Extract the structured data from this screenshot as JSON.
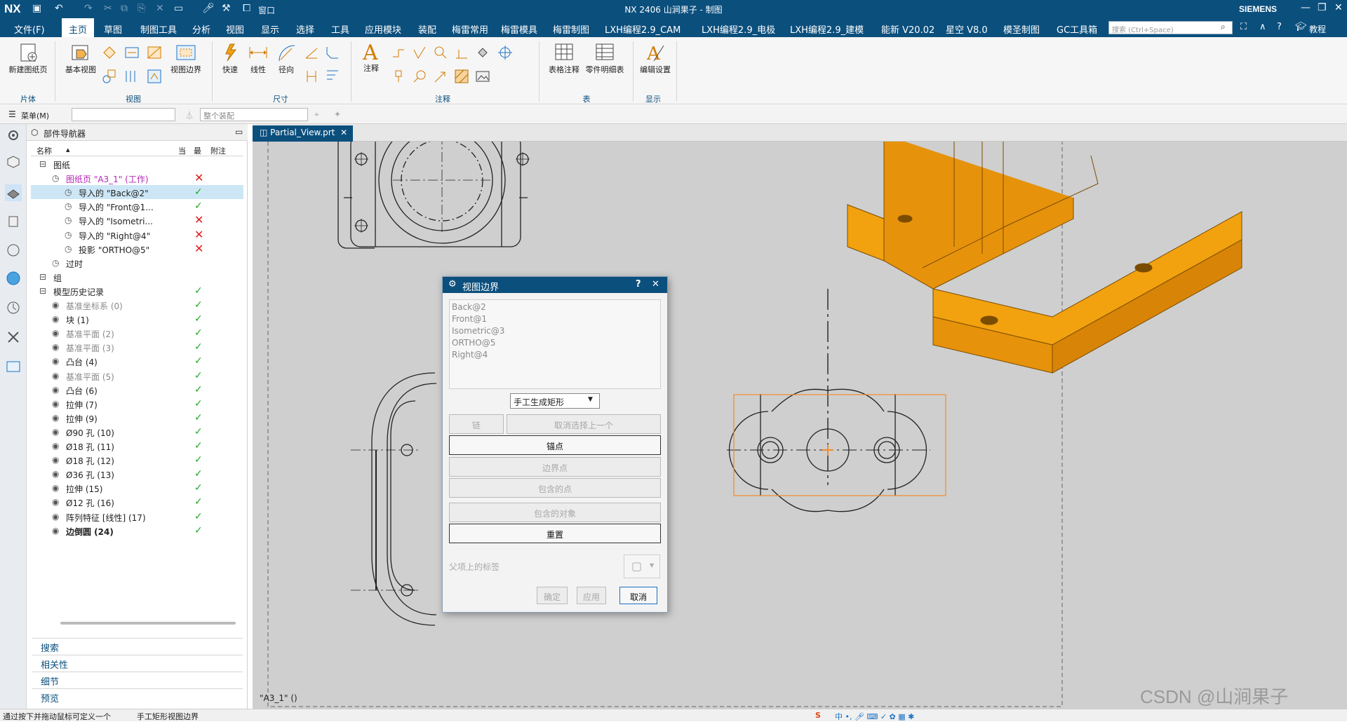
{
  "titlebar": {
    "app_logo": "NX",
    "title": "NX 2406 山涧果子 - 制图",
    "brand": "SIEMENS",
    "window_label": "窗口"
  },
  "menubar": {
    "items": [
      "文件(F)",
      "主页",
      "草图",
      "制图工具",
      "分析",
      "视图",
      "显示",
      "选择",
      "工具",
      "应用模块",
      "装配",
      "梅雷常用",
      "梅雷模具",
      "梅雷制图",
      "LXH编程2.9_CAM",
      "LXH编程2.9_电极",
      "LXH编程2.9_建模",
      "能新 V20.02",
      "星空 V8.0",
      "模圣制图",
      "GC工具箱"
    ],
    "active_index": 1,
    "search_placeholder": "搜索 (Ctrl+Space)",
    "tutorial": "教程"
  },
  "ribbon": {
    "buttons": {
      "new_sheet": "新建图纸页",
      "base_view": "基本视图",
      "view_boundary": "视图边界",
      "rapid": "快速",
      "linear": "线性",
      "radial": "径向",
      "note": "注释",
      "table_note": "表格注释",
      "parts_list": "零件明细表",
      "edit_settings": "编辑设置"
    },
    "groups": [
      "片体",
      "视图",
      "尺寸",
      "注释",
      "表",
      "显示"
    ]
  },
  "selbar": {
    "menu": "菜单(M)",
    "assembly_filter": "整个装配"
  },
  "navigator": {
    "title": "部件导航器",
    "columns": [
      "名称",
      "当",
      "最",
      "附注"
    ],
    "rows": [
      {
        "text": "图纸",
        "indent": 0,
        "state": ""
      },
      {
        "text": "图纸页 \"A3_1\" (工作)",
        "indent": 1,
        "state": "x",
        "style": "pink"
      },
      {
        "text": "导入的 \"Back@2\"",
        "indent": 2,
        "state": "check",
        "selected": true
      },
      {
        "text": "导入的 \"Front@1...",
        "indent": 2,
        "state": "check"
      },
      {
        "text": "导入的 \"Isometri...",
        "indent": 2,
        "state": "x"
      },
      {
        "text": "导入的 \"Right@4\"",
        "indent": 2,
        "state": "x"
      },
      {
        "text": "投影 \"ORTHO@5\"",
        "indent": 2,
        "state": "x"
      },
      {
        "text": "过时",
        "indent": 1,
        "state": ""
      },
      {
        "text": "组",
        "indent": 0,
        "state": ""
      },
      {
        "text": "模型历史记录",
        "indent": 0,
        "state": "check"
      },
      {
        "text": "基准坐标系 (0)",
        "indent": 1,
        "state": "check",
        "style": "gray"
      },
      {
        "text": "块 (1)",
        "indent": 1,
        "state": "check"
      },
      {
        "text": "基准平面 (2)",
        "indent": 1,
        "state": "check",
        "style": "gray"
      },
      {
        "text": "基准平面 (3)",
        "indent": 1,
        "state": "check",
        "style": "gray"
      },
      {
        "text": "凸台 (4)",
        "indent": 1,
        "state": "check"
      },
      {
        "text": "基准平面 (5)",
        "indent": 1,
        "state": "check",
        "style": "gray"
      },
      {
        "text": "凸台 (6)",
        "indent": 1,
        "state": "check"
      },
      {
        "text": "拉伸 (7)",
        "indent": 1,
        "state": "check"
      },
      {
        "text": "拉伸 (9)",
        "indent": 1,
        "state": "check"
      },
      {
        "text": "Ø90 孔 (10)",
        "indent": 1,
        "state": "check"
      },
      {
        "text": "Ø18 孔 (11)",
        "indent": 1,
        "state": "check"
      },
      {
        "text": "Ø18 孔 (12)",
        "indent": 1,
        "state": "check"
      },
      {
        "text": "Ø36 孔 (13)",
        "indent": 1,
        "state": "check"
      },
      {
        "text": "拉伸 (15)",
        "indent": 1,
        "state": "check"
      },
      {
        "text": "Ø12 孔 (16)",
        "indent": 1,
        "state": "check"
      },
      {
        "text": "阵列特征 [线性] (17)",
        "indent": 1,
        "state": "check"
      },
      {
        "text": "边倒圆 (24)",
        "indent": 1,
        "state": "check",
        "style": "bold"
      }
    ],
    "sections": [
      "搜索",
      "相关性",
      "细节",
      "预览"
    ]
  },
  "tab": {
    "label": "Partial_View.prt"
  },
  "canvas": {
    "sheet_label": "\"A3_1\"  ()"
  },
  "dialog": {
    "title": "视图边界",
    "help": "?",
    "views": [
      "Back@2",
      "Front@1",
      "Isometric@3",
      "ORTHO@5",
      "Right@4"
    ],
    "mode": "手工生成矩形",
    "chain": "链",
    "cancel_last": "取消选择上一个",
    "anchor": "锚点",
    "boundary_point": "边界点",
    "include_point": "包含的点",
    "include_object": "包含的对象",
    "reset": "重置",
    "parent_label": "父项上的标签",
    "ok": "确定",
    "apply": "应用",
    "cancel": "取消"
  },
  "status": {
    "hint": "通过按下并拖动鼠标可定义一个",
    "mode": "手工矩形视图边界",
    "watermark": "CSDN @山涧果子"
  },
  "colors": {
    "title_bg": "#0b4f7d",
    "accent_orange": "#f2a10f",
    "canvas_bg": "#cfcfcf"
  }
}
